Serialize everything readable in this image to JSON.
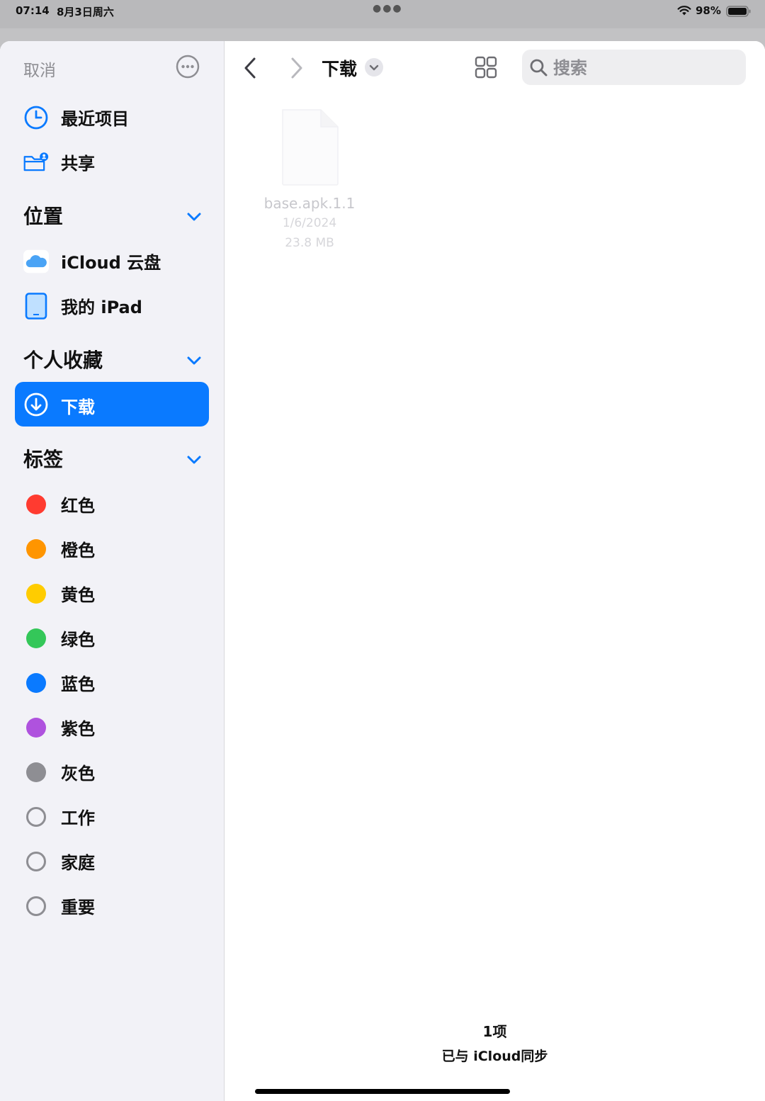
{
  "status_bar": {
    "time": "07:14",
    "date": "8月3日周六",
    "battery": "98%"
  },
  "sidebar": {
    "cancel_label": "取消",
    "top_items": [
      {
        "label": "最近项目",
        "icon": "clock-icon"
      },
      {
        "label": "共享",
        "icon": "shared-folder-icon"
      }
    ],
    "sections": {
      "locations": {
        "title": "位置",
        "items": [
          {
            "label": "iCloud 云盘",
            "icon": "icloud-icon"
          },
          {
            "label": "我的 iPad",
            "icon": "ipad-icon"
          }
        ]
      },
      "favorites": {
        "title": "个人收藏",
        "items": [
          {
            "label": "下载",
            "icon": "download-icon",
            "selected": true
          }
        ]
      },
      "tags": {
        "title": "标签",
        "items": [
          {
            "label": "红色",
            "color": "#ff3b30"
          },
          {
            "label": "橙色",
            "color": "#ff9500"
          },
          {
            "label": "黄色",
            "color": "#ffcc00"
          },
          {
            "label": "绿色",
            "color": "#34c759"
          },
          {
            "label": "蓝色",
            "color": "#0a7aff"
          },
          {
            "label": "紫色",
            "color": "#af52de"
          },
          {
            "label": "灰色",
            "color": "#8e8e93"
          },
          {
            "label": "工作",
            "color": null
          },
          {
            "label": "家庭",
            "color": null
          },
          {
            "label": "重要",
            "color": null
          }
        ]
      }
    }
  },
  "toolbar": {
    "folder_title": "下载",
    "search_placeholder": "搜索"
  },
  "files": [
    {
      "name": "base.apk.1.1",
      "date": "1/6/2024",
      "size": "23.8 MB"
    }
  ],
  "footer": {
    "item_count": "1项",
    "sync_status": "已与 iCloud同步"
  },
  "colors": {
    "accent": "#0a7aff",
    "sidebar_bg": "#f2f2f7"
  }
}
